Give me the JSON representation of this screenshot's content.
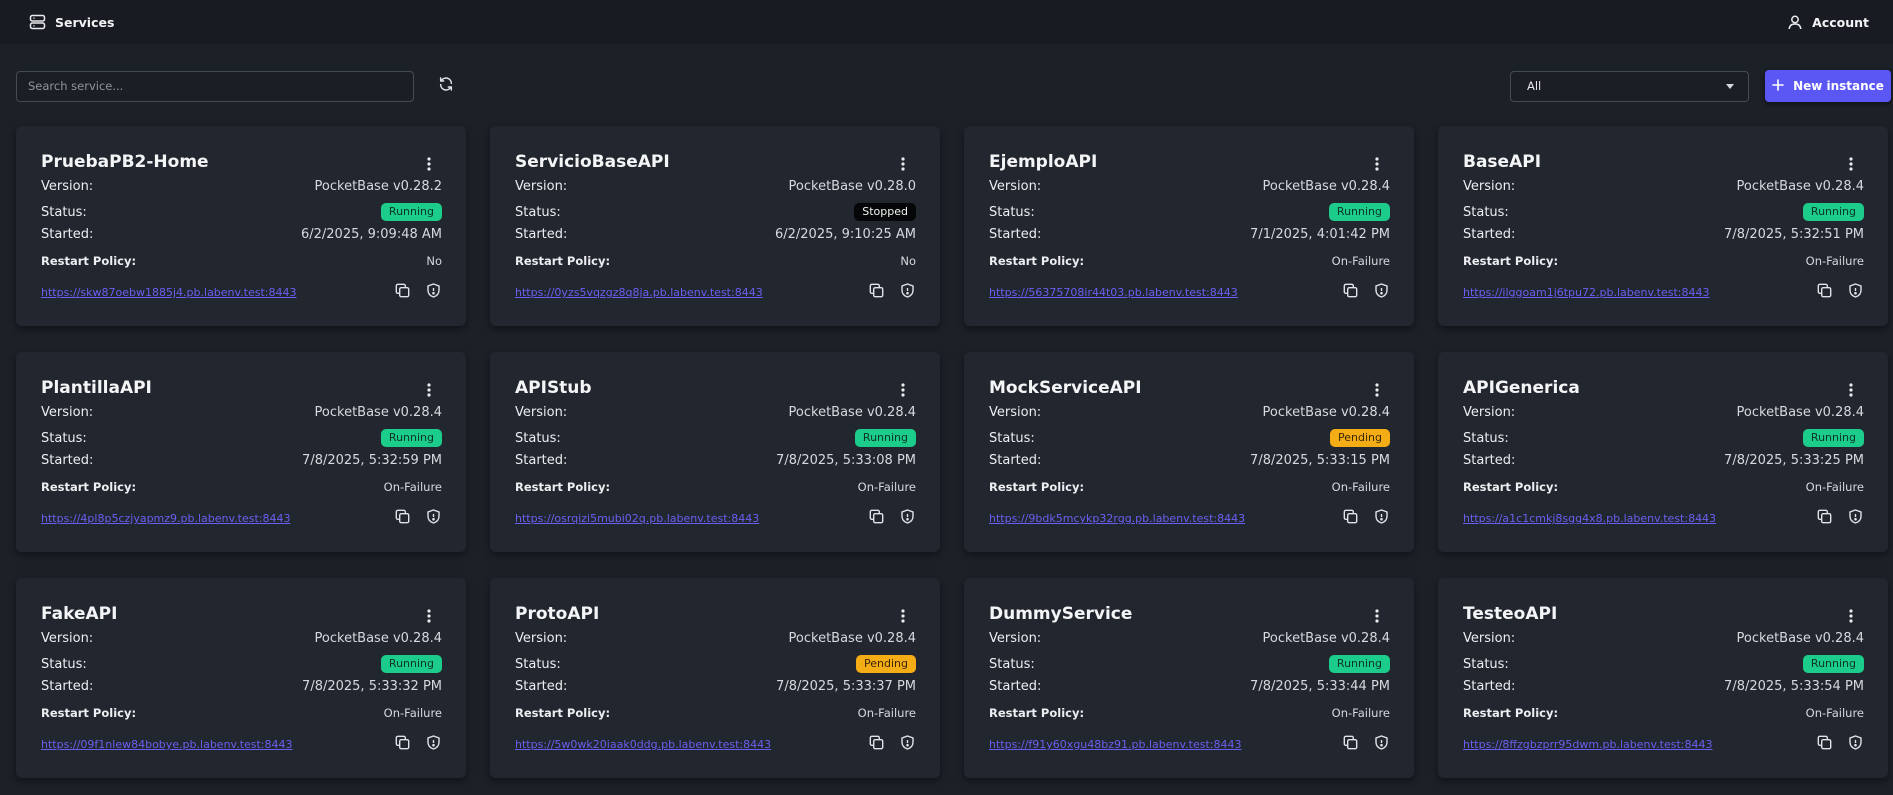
{
  "header": {
    "title": "Services",
    "account_label": "Account"
  },
  "toolbar": {
    "search_placeholder": "Search service...",
    "filter_selected": "All",
    "new_instance_label": "New instance"
  },
  "labels": {
    "version": "Version:",
    "status": "Status:",
    "started": "Started:",
    "restart_policy": "Restart Policy:"
  },
  "colors": {
    "accent": "#5b57f4",
    "running": "#1ccc8a",
    "pending": "#f5ad16",
    "stopped": "#050607",
    "link": "#6b5ff2"
  },
  "icons": {
    "brand": "server-icon",
    "account": "user-icon",
    "refresh": "refresh-icon",
    "add": "plus-icon",
    "menu": "kebab-menu-icon",
    "copy": "copy-icon",
    "shield": "shield-icon"
  },
  "services": [
    {
      "name": "PruebaPB2-Home",
      "version": "PocketBase v0.28.2",
      "status": "Running",
      "status_kind": "running",
      "started": "6/2/2025, 9:09:48 AM",
      "restart_policy": "No",
      "url": "https://skw87oebw1885j4.pb.labenv.test:8443"
    },
    {
      "name": "ServicioBaseAPI",
      "version": "PocketBase v0.28.0",
      "status": "Stopped",
      "status_kind": "stopped",
      "started": "6/2/2025, 9:10:25 AM",
      "restart_policy": "No",
      "url": "https://0yzs5vqzgz8q8ja.pb.labenv.test:8443"
    },
    {
      "name": "EjemploAPI",
      "version": "PocketBase v0.28.4",
      "status": "Running",
      "status_kind": "running",
      "started": "7/1/2025, 4:01:42 PM",
      "restart_policy": "On-Failure",
      "url": "https://56375708ir44t03.pb.labenv.test:8443"
    },
    {
      "name": "BaseAPI",
      "version": "PocketBase v0.28.4",
      "status": "Running",
      "status_kind": "running",
      "started": "7/8/2025, 5:32:51 PM",
      "restart_policy": "On-Failure",
      "url": "https://ilggoam1j6tpu72.pb.labenv.test:8443"
    },
    {
      "name": "PlantillaAPI",
      "version": "PocketBase v0.28.4",
      "status": "Running",
      "status_kind": "running",
      "started": "7/8/2025, 5:32:59 PM",
      "restart_policy": "On-Failure",
      "url": "https://4pl8p5czjyapmz9.pb.labenv.test:8443"
    },
    {
      "name": "APIStub",
      "version": "PocketBase v0.28.4",
      "status": "Running",
      "status_kind": "running",
      "started": "7/8/2025, 5:33:08 PM",
      "restart_policy": "On-Failure",
      "url": "https://osrqizi5mubi02q.pb.labenv.test:8443"
    },
    {
      "name": "MockServiceAPI",
      "version": "PocketBase v0.28.4",
      "status": "Pending",
      "status_kind": "pending",
      "started": "7/8/2025, 5:33:15 PM",
      "restart_policy": "On-Failure",
      "url": "https://9bdk5mcykp32rgg.pb.labenv.test:8443"
    },
    {
      "name": "APIGenerica",
      "version": "PocketBase v0.28.4",
      "status": "Running",
      "status_kind": "running",
      "started": "7/8/2025, 5:33:25 PM",
      "restart_policy": "On-Failure",
      "url": "https://a1c1cmkj8sgg4x8.pb.labenv.test:8443"
    },
    {
      "name": "FakeAPI",
      "version": "PocketBase v0.28.4",
      "status": "Running",
      "status_kind": "running",
      "started": "7/8/2025, 5:33:32 PM",
      "restart_policy": "On-Failure",
      "url": "https://09f1nlew84bobye.pb.labenv.test:8443"
    },
    {
      "name": "ProtoAPI",
      "version": "PocketBase v0.28.4",
      "status": "Pending",
      "status_kind": "pending",
      "started": "7/8/2025, 5:33:37 PM",
      "restart_policy": "On-Failure",
      "url": "https://5w0wk20iaak0ddg.pb.labenv.test:8443"
    },
    {
      "name": "DummyService",
      "version": "PocketBase v0.28.4",
      "status": "Running",
      "status_kind": "running",
      "started": "7/8/2025, 5:33:44 PM",
      "restart_policy": "On-Failure",
      "url": "https://f91y60xgu48bz91.pb.labenv.test:8443"
    },
    {
      "name": "TesteoAPI",
      "version": "PocketBase v0.28.4",
      "status": "Running",
      "status_kind": "running",
      "started": "7/8/2025, 5:33:54 PM",
      "restart_policy": "On-Failure",
      "url": "https://8ffzgbzprr95dwm.pb.labenv.test:8443"
    }
  ]
}
